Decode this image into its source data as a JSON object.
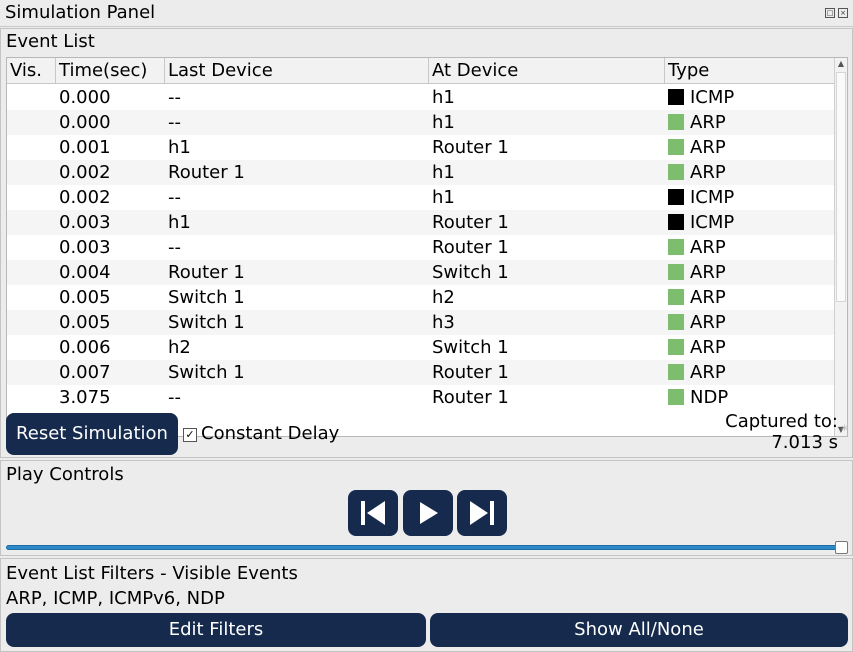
{
  "window": {
    "title": "Simulation Panel",
    "restore_icon": "restore-icon",
    "close_icon": "close-icon"
  },
  "event_list": {
    "section_title": "Event List",
    "columns": [
      "Vis.",
      "Time(sec)",
      "Last Device",
      "At Device",
      "Type"
    ],
    "rows": [
      {
        "vis": "",
        "time": "0.000",
        "last_device": "--",
        "at_device": "h1",
        "type": "ICMP",
        "color": "#000000"
      },
      {
        "vis": "",
        "time": "0.000",
        "last_device": "--",
        "at_device": "h1",
        "type": "ARP",
        "color": "#7dbe6e"
      },
      {
        "vis": "",
        "time": "0.001",
        "last_device": "h1",
        "at_device": "Router 1",
        "type": "ARP",
        "color": "#7dbe6e"
      },
      {
        "vis": "",
        "time": "0.002",
        "last_device": "Router 1",
        "at_device": "h1",
        "type": "ARP",
        "color": "#7dbe6e"
      },
      {
        "vis": "",
        "time": "0.002",
        "last_device": "--",
        "at_device": "h1",
        "type": "ICMP",
        "color": "#000000"
      },
      {
        "vis": "",
        "time": "0.003",
        "last_device": "h1",
        "at_device": "Router 1",
        "type": "ICMP",
        "color": "#000000"
      },
      {
        "vis": "",
        "time": "0.003",
        "last_device": "--",
        "at_device": "Router 1",
        "type": "ARP",
        "color": "#7dbe6e"
      },
      {
        "vis": "",
        "time": "0.004",
        "last_device": "Router 1",
        "at_device": "Switch 1",
        "type": "ARP",
        "color": "#7dbe6e"
      },
      {
        "vis": "",
        "time": "0.005",
        "last_device": "Switch 1",
        "at_device": "h2",
        "type": "ARP",
        "color": "#7dbe6e"
      },
      {
        "vis": "",
        "time": "0.005",
        "last_device": "Switch 1",
        "at_device": "h3",
        "type": "ARP",
        "color": "#7dbe6e"
      },
      {
        "vis": "",
        "time": "0.006",
        "last_device": "h2",
        "at_device": "Switch 1",
        "type": "ARP",
        "color": "#7dbe6e"
      },
      {
        "vis": "",
        "time": "0.007",
        "last_device": "Switch 1",
        "at_device": "Router 1",
        "type": "ARP",
        "color": "#7dbe6e"
      },
      {
        "vis": "",
        "time": "3.075",
        "last_device": "--",
        "at_device": "Router 1",
        "type": "NDP",
        "color": "#7dbe6e"
      }
    ],
    "reset_label": "Reset Simulation",
    "constant_delay_label": "Constant Delay",
    "constant_delay_checked": true,
    "captured_label": "Captured to:",
    "captured_value": "7.013 s",
    "asterisk": "*"
  },
  "play_controls": {
    "section_title": "Play Controls",
    "buttons": [
      "back-icon",
      "play-icon",
      "forward-icon"
    ],
    "slider_position_percent": 100
  },
  "filters": {
    "section_title": "Event List Filters - Visible Events",
    "visible_events": "ARP, ICMP, ICMPv6, NDP",
    "edit_label": "Edit Filters",
    "show_label": "Show All/None"
  },
  "colors": {
    "button_bg": "#152a4d",
    "slider": "#2c89c8",
    "icmp": "#000000",
    "arp": "#7dbe6e"
  }
}
